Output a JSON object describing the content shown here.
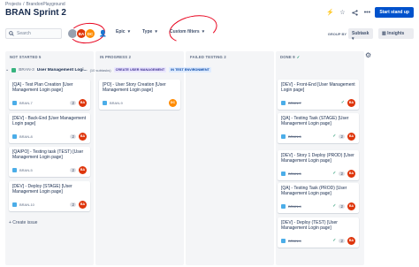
{
  "breadcrumb": {
    "items": [
      "Projects",
      "BrandonPlayground"
    ]
  },
  "page": {
    "title": "BRAN Sprint 2"
  },
  "top_actions": {
    "icons": [
      "lightning-icon",
      "star-icon",
      "share-icon",
      "more-icon"
    ],
    "standup_label": "Start stand up"
  },
  "toolbar": {
    "search_placeholder": "Search",
    "avatars": [
      "BA",
      "DC"
    ],
    "epic_label": "Epic",
    "type_label": "Type",
    "custom_filters_label": "Custom filters",
    "group_by_label": "GROUP BY",
    "group_by_value": "Subtask",
    "insights_label": "Insights"
  },
  "columns": [
    {
      "label": "NOT STARTED 5"
    },
    {
      "label": "IN PROGRESS 2"
    },
    {
      "label": "FAILED TESTING 2"
    },
    {
      "label": "DONE 9"
    }
  ],
  "swimlane": {
    "key": "BRAN-3",
    "summary": "User Management Logi...",
    "count": "(10 subtasks)",
    "badge_create": "CREATE USER MANAGEMENT",
    "badge_env": "IN TEST ENVIRONMENT"
  },
  "cards": {
    "c1": {
      "title": "[QA] - Test Plan Creation [User Management Login page]",
      "key": "BRAN-7",
      "points": "2",
      "avatar": "BA"
    },
    "c2": {
      "title": "[DEV] - Back-End [User Management Login page]",
      "key": "BRAN-8",
      "points": "2",
      "avatar": "BA"
    },
    "c3": {
      "title": "[QA/PO] - Testing task (TEST) [User Management Login page]",
      "key": "BRAN-5",
      "points": "2",
      "avatar": "BA"
    },
    "c4": {
      "title": "[DEV] - Deploy (STAGE) [User Management Login page]",
      "key": "BRAN-10",
      "points": "2",
      "avatar": "BA"
    },
    "c5": {
      "title": "[PO] - User Story Creation [User Management Login page]",
      "key": "BRAN-9",
      "avatar": "DC"
    },
    "d1": {
      "title": "[DEV] - Front-End [User Management Login page]",
      "key": "BRAN-7",
      "avatar": "BA"
    },
    "d2": {
      "title": "[QA] - Testing Task (STAGE) [User Management Login page]",
      "key": "BRAN-6",
      "points": "2",
      "avatar": "BA"
    },
    "d3": {
      "title": "[DEV] - Story 1 Deploy (PROD) [User Management Login page]",
      "key": "BRAN-5",
      "points": "2",
      "avatar": "BA"
    },
    "d4": {
      "title": "[QA] - Testing Task (PROD) [User Management Login page]",
      "key": "BRAN-4",
      "points": "2",
      "avatar": "BA"
    },
    "d5": {
      "title": "[DEV] - Deploy (TEST) [User Management Login page]",
      "key": "BRAN-4",
      "points": "2",
      "avatar": "BA"
    }
  },
  "create_issue_label": "+ Create issue",
  "colors": {
    "accent": "#0052cc",
    "avatar_ba": "#de350b",
    "avatar_dc": "#ff8b00",
    "annotation": "#e8001c",
    "done_check": "#00875a"
  }
}
